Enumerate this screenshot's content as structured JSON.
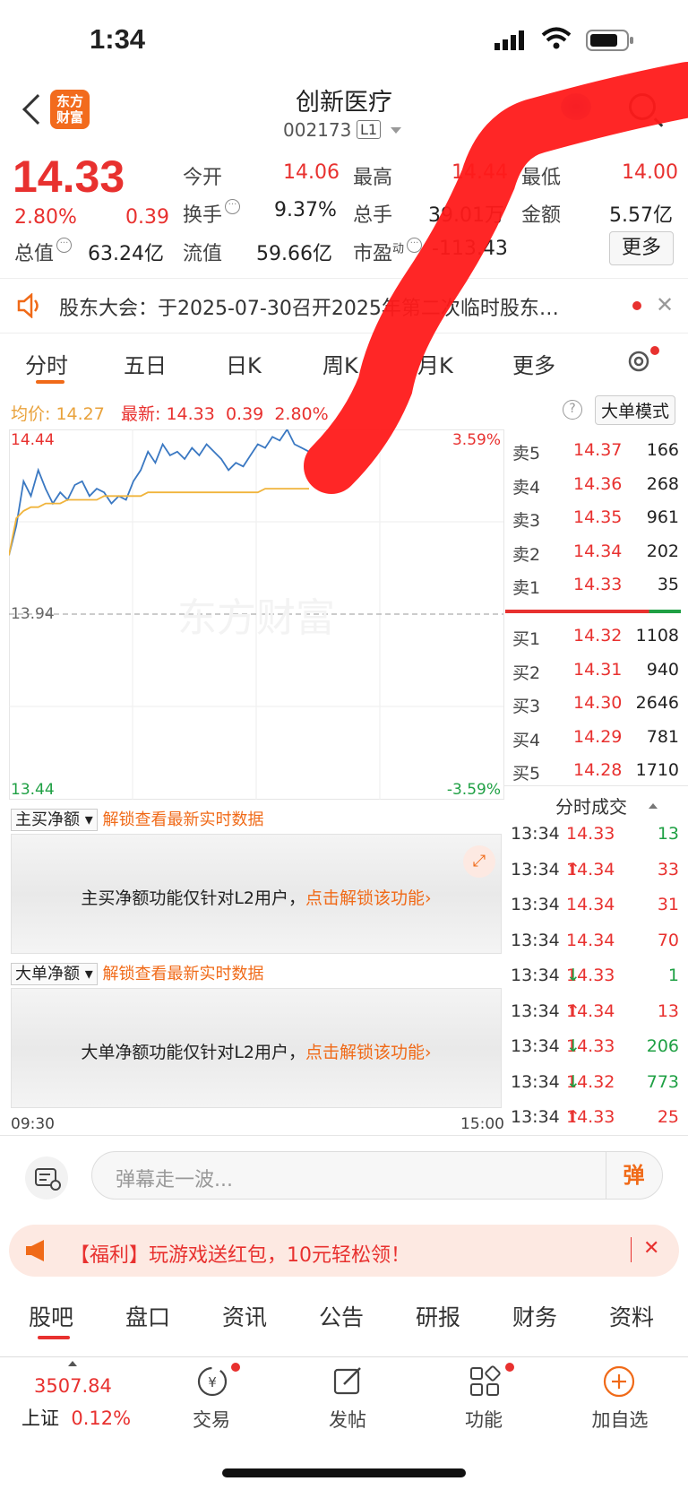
{
  "status": {
    "time": "1:34"
  },
  "header": {
    "title": "创新医疗",
    "code": "002173",
    "level": "L1",
    "logo": "东方\n财富"
  },
  "quote": {
    "price": "14.33",
    "change_pct": "2.80%",
    "change": "0.39",
    "open_label": "今开",
    "open": "14.06",
    "high_label": "最高",
    "high": "14.44",
    "low_label": "最低",
    "low": "14.00",
    "turnover_label": "换手",
    "turnover": "9.37%",
    "volume_label": "总手",
    "volume": "39.01万",
    "amount_label": "金额",
    "amount": "5.57亿",
    "total_value_label": "总值",
    "total_value": "63.24亿",
    "float_value_label": "流值",
    "float_value": "59.66亿",
    "pe_label": "市盈",
    "pe_sup": "动",
    "pe": "-113.43",
    "more": "更多",
    "dots": "···"
  },
  "notice": {
    "text": "股东大会：于2025-07-30召开2025年第二次临时股东…"
  },
  "tabs": [
    "分时",
    "五日",
    "日K",
    "周K",
    "月K",
    "更多"
  ],
  "legend": {
    "avg_label": "均价:",
    "avg": "14.27",
    "latest_label": "最新:",
    "latest": "14.33",
    "chg": "0.39",
    "pct": "2.80%",
    "help": "?",
    "big_mode": "大单模式"
  },
  "chart_data": {
    "type": "line",
    "series": [
      {
        "name": "最新",
        "values": [
          14.1,
          14.18,
          14.3,
          14.26,
          14.33,
          14.28,
          14.24,
          14.27,
          14.25,
          14.29,
          14.3,
          14.26,
          14.28,
          14.27,
          14.24,
          14.26,
          14.25,
          14.3,
          14.33,
          14.38,
          14.35,
          14.4,
          14.37,
          14.38,
          14.36,
          14.39,
          14.37,
          14.4,
          14.38,
          14.36,
          14.33,
          14.35,
          14.34,
          14.37,
          14.4,
          14.39,
          14.42,
          14.41,
          14.44,
          14.4,
          14.39,
          14.38
        ]
      },
      {
        "name": "均价",
        "values": [
          14.1,
          14.2,
          14.22,
          14.23,
          14.23,
          14.24,
          14.24,
          14.24,
          14.25,
          14.25,
          14.25,
          14.25,
          14.25,
          14.26,
          14.26,
          14.26,
          14.26,
          14.26,
          14.26,
          14.27,
          14.27,
          14.27,
          14.27,
          14.27,
          14.27,
          14.27,
          14.27,
          14.27,
          14.27,
          14.27,
          14.27,
          14.27,
          14.27,
          14.27,
          14.27,
          14.28,
          14.28,
          14.28,
          14.28,
          14.28,
          14.28,
          14.28
        ]
      }
    ],
    "ylim": [
      13.44,
      14.44
    ],
    "prev_close": "13.94",
    "y_top": "14.44",
    "y_bottom": "13.44",
    "pct_top": "3.59%",
    "pct_bottom": "-3.59%",
    "x_start": "09:30",
    "x_end": "15:00",
    "watermark": "东方财富"
  },
  "orderbook": {
    "sell": [
      {
        "label": "卖5",
        "price": "14.37",
        "vol": "166"
      },
      {
        "label": "卖4",
        "price": "14.36",
        "vol": "268"
      },
      {
        "label": "卖3",
        "price": "14.35",
        "vol": "961"
      },
      {
        "label": "卖2",
        "price": "14.34",
        "vol": "202"
      },
      {
        "label": "卖1",
        "price": "14.33",
        "vol": "35"
      }
    ],
    "buy": [
      {
        "label": "买1",
        "price": "14.32",
        "vol": "1108"
      },
      {
        "label": "买2",
        "price": "14.31",
        "vol": "940"
      },
      {
        "label": "买3",
        "price": "14.30",
        "vol": "2646"
      },
      {
        "label": "买4",
        "price": "14.29",
        "vol": "781"
      },
      {
        "label": "买5",
        "price": "14.28",
        "vol": "1710"
      }
    ]
  },
  "ticks": {
    "title": "分时成交",
    "rows": [
      {
        "t": "13:34",
        "p": "14.33",
        "a": "",
        "v": "13",
        "vc": "green"
      },
      {
        "t": "13:34",
        "p": "14.34",
        "a": "↑",
        "v": "33",
        "vc": "red"
      },
      {
        "t": "13:34",
        "p": "14.34",
        "a": "",
        "v": "31",
        "vc": "red"
      },
      {
        "t": "13:34",
        "p": "14.34",
        "a": "",
        "v": "70",
        "vc": "red"
      },
      {
        "t": "13:34",
        "p": "14.33",
        "a": "↓",
        "v": "1",
        "vc": "green"
      },
      {
        "t": "13:34",
        "p": "14.34",
        "a": "↑",
        "v": "13",
        "vc": "red"
      },
      {
        "t": "13:34",
        "p": "14.33",
        "a": "↓",
        "v": "206",
        "vc": "green"
      },
      {
        "t": "13:34",
        "p": "14.32",
        "a": "↓",
        "v": "773",
        "vc": "green"
      },
      {
        "t": "13:34",
        "p": "14.33",
        "a": "↑",
        "v": "25",
        "vc": "red"
      }
    ]
  },
  "panels": {
    "main": {
      "select": "主买净额",
      "unlock": "解锁查看最新实时数据",
      "msg": "主买净额功能仅针对L2用户，",
      "link": "点击解锁该功能"
    },
    "big": {
      "select": "大单净额",
      "unlock": "解锁查看最新实时数据",
      "msg": "大单净额功能仅针对L2用户，",
      "link": "点击解锁该功能"
    }
  },
  "danmu": {
    "placeholder": "弹幕走一波...",
    "send": "弹"
  },
  "promo": {
    "text": "【福利】玩游戏送红包，10元轻松领！"
  },
  "bottom_tabs": [
    "股吧",
    "盘口",
    "资讯",
    "公告",
    "研报",
    "财务",
    "资料"
  ],
  "nav": {
    "index_value": "3507.84",
    "index_name": "上证",
    "index_pct": "0.12%",
    "items": [
      "交易",
      "发帖",
      "功能",
      "加自选"
    ]
  },
  "colors": {
    "up": "#e8312f",
    "down": "#1fa044",
    "accent": "#f06a18",
    "price_line": "#3a78c2",
    "avg_line": "#f0b43c"
  }
}
